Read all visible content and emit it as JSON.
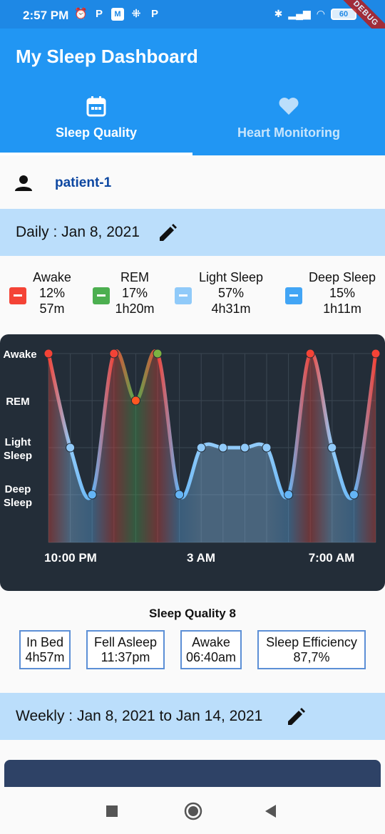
{
  "status": {
    "time": "2:57 PM",
    "battery": "60",
    "left_icons": [
      "alarm-icon",
      "p-icon",
      "m-icon",
      "grid-icon",
      "p-icon"
    ],
    "debug": "DEBUG"
  },
  "app": {
    "title": "My Sleep Dashboard"
  },
  "tabs": [
    {
      "label": "Sleep Quality",
      "icon": "calendar-icon",
      "selected": true
    },
    {
      "label": "Heart Monitoring",
      "icon": "heart-icon",
      "selected": false
    }
  ],
  "patient": {
    "name": "patient-1",
    "icon": "person-icon"
  },
  "daily": {
    "label": "Daily : Jan 8, 2021"
  },
  "legend": [
    {
      "name": "Awake",
      "percent": "12%",
      "duration": "57m",
      "color": "#f44336"
    },
    {
      "name": "REM",
      "percent": "17%",
      "duration": "1h20m",
      "color": "#4caf50"
    },
    {
      "name": "Light Sleep",
      "percent": "57%",
      "duration": "4h31m",
      "color": "#90caf9"
    },
    {
      "name": "Deep Sleep",
      "percent": "15%",
      "duration": "1h11m",
      "color": "#42a5f5"
    }
  ],
  "chart_data": {
    "type": "line",
    "y_categories": [
      "Deep Sleep",
      "Light Sleep",
      "REM",
      "Awake"
    ],
    "y_tick_labels": [
      "Awake",
      "REM",
      "Light\nSleep",
      "Deep\nSleep"
    ],
    "x_tick_labels": [
      "10:00 PM",
      "3 AM",
      "7:00 AM"
    ],
    "grid": true,
    "points": [
      {
        "stage": "Awake"
      },
      {
        "stage": "Light Sleep"
      },
      {
        "stage": "Deep Sleep"
      },
      {
        "stage": "Awake"
      },
      {
        "stage": "REM"
      },
      {
        "stage": "Awake"
      },
      {
        "stage": "Deep Sleep"
      },
      {
        "stage": "Light Sleep"
      },
      {
        "stage": "Light Sleep"
      },
      {
        "stage": "Light Sleep"
      },
      {
        "stage": "Light Sleep"
      },
      {
        "stage": "Deep Sleep"
      },
      {
        "stage": "Awake"
      },
      {
        "stage": "Light Sleep"
      },
      {
        "stage": "Deep Sleep"
      },
      {
        "stage": "Awake"
      }
    ],
    "stage_colors": {
      "Awake": "#f44336",
      "REM": "#ff5722",
      "Light Sleep": "#90caf9",
      "Deep Sleep": "#64b5f6"
    }
  },
  "sleep_quality": {
    "label": "Sleep Quality 8"
  },
  "stats": [
    {
      "label": "In Bed",
      "value": "4h57m"
    },
    {
      "label": "Fell Asleep",
      "value": "11:37pm"
    },
    {
      "label": "Awake",
      "value": "06:40am"
    },
    {
      "label": "Sleep Efficiency",
      "value": "87,7%"
    }
  ],
  "weekly": {
    "label": "Weekly : Jan 8, 2021 to Jan 14, 2021"
  },
  "nav": {
    "buttons": [
      "recents-icon",
      "home-icon",
      "back-icon"
    ]
  }
}
